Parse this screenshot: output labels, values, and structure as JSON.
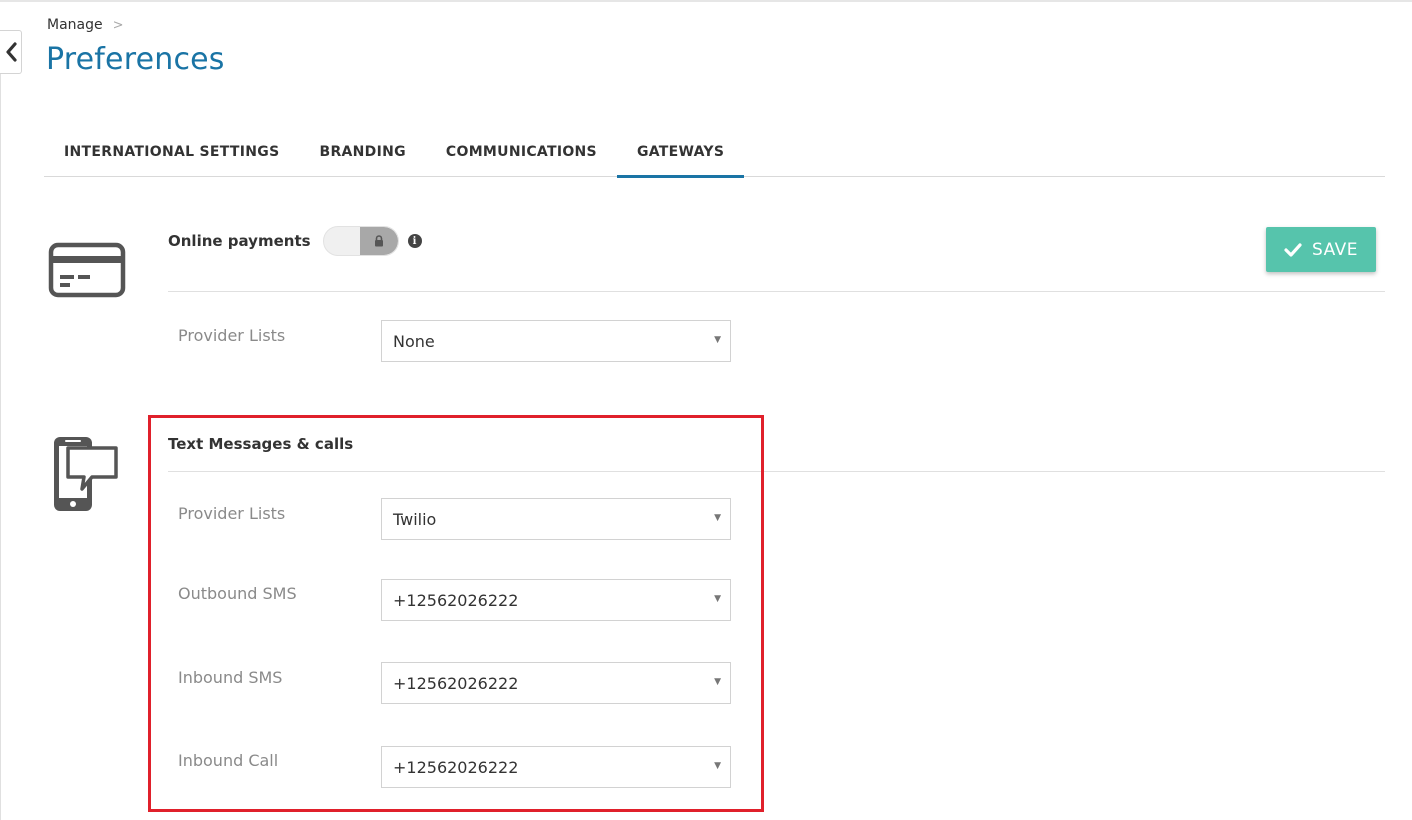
{
  "breadcrumb": {
    "parent": "Manage",
    "separator": ">"
  },
  "page": {
    "title": "Preferences"
  },
  "tabs": [
    {
      "label": "INTERNATIONAL SETTINGS",
      "active": false
    },
    {
      "label": "BRANDING",
      "active": false
    },
    {
      "label": "COMMUNICATIONS",
      "active": false
    },
    {
      "label": "GATEWAYS",
      "active": true
    }
  ],
  "online_payments": {
    "label": "Online payments",
    "toggle_state": "off-locked",
    "provider": {
      "label": "Provider Lists",
      "value": "None"
    }
  },
  "save_button": {
    "label": "SAVE",
    "icon": "checkmark-icon"
  },
  "text_messages": {
    "title": "Text Messages & calls",
    "fields": [
      {
        "label": "Provider Lists",
        "value": "Twilio"
      },
      {
        "label": "Outbound SMS",
        "value": "+12562026222"
      },
      {
        "label": "Inbound SMS",
        "value": "+12562026222"
      },
      {
        "label": "Inbound Call",
        "value": "+12562026222"
      }
    ]
  },
  "colors": {
    "accent": "#1a74a5",
    "save": "#56c4ac",
    "highlight": "#e0202b"
  }
}
